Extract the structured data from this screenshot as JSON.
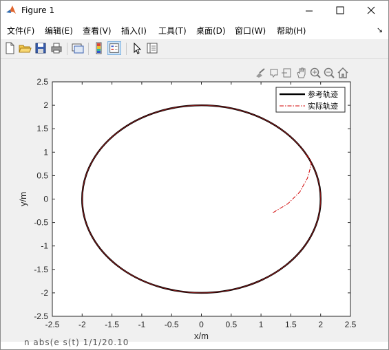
{
  "window": {
    "title": "Figure 1",
    "icon": "matlab-icon",
    "controls": [
      "minimize-icon",
      "maximize-icon",
      "close-icon"
    ]
  },
  "menu": {
    "items": [
      {
        "label": "文件(F)"
      },
      {
        "label": "编辑(E)"
      },
      {
        "label": "查看(V)"
      },
      {
        "label": "插入(I)"
      },
      {
        "label": "工具(T)"
      },
      {
        "label": "桌面(D)"
      },
      {
        "label": "窗口(W)"
      },
      {
        "label": "帮助(H)"
      }
    ],
    "overflow_icon": "menu-overflow-arrow-icon"
  },
  "toolbar": {
    "icons": [
      "new-figure-icon",
      "open-file-icon",
      "save-icon",
      "print-icon",
      "link-plot-icon",
      "insert-colorbar-icon",
      "insert-legend-icon",
      "edit-plot-arrow-icon",
      "property-inspector-icon"
    ],
    "pressed": "insert-legend-icon"
  },
  "axes_toolbar": {
    "icons": [
      "brush-icon",
      "data-tips-icon",
      "export-icon",
      "pan-hand-icon",
      "zoom-in-icon",
      "zoom-out-icon",
      "home-icon"
    ]
  },
  "chart_data": {
    "type": "line",
    "xlabel": "x/m",
    "ylabel": "y/m",
    "xlim": [
      -2.5,
      2.5
    ],
    "ylim": [
      -2.5,
      2.5
    ],
    "xticks": [
      "-2.5",
      "-2",
      "-1.5",
      "-1",
      "-0.5",
      "0",
      "0.5",
      "1",
      "1.5",
      "2",
      "2.5"
    ],
    "yticks": [
      "2.5",
      "2",
      "1.5",
      "1",
      "0.5",
      "0",
      "-0.5",
      "-1",
      "-1.5",
      "-2",
      "-2.5"
    ],
    "grid": false,
    "legend_position": "top-right",
    "series": [
      {
        "name": "参考轨迹",
        "color": "#000000",
        "style": "solid",
        "shape": "circle",
        "center": [
          0,
          0
        ],
        "radius": 2
      },
      {
        "name": "实际轨迹",
        "color": "#d00000",
        "style": "dash-dot",
        "x": [
          1.2,
          1.45,
          1.65,
          1.78,
          1.84,
          1.83,
          1.75
        ],
        "y": [
          -0.29,
          -0.1,
          0.15,
          0.45,
          0.72,
          0.84,
          0.95
        ]
      },
      {
        "name": "",
        "color": "#8b1a1a",
        "style": "solid",
        "shape": "circle",
        "center": [
          0,
          0
        ],
        "radius": 2
      }
    ]
  },
  "bottom_strip": {
    "text": "n  abs(e  s(t) 1/1/20.10"
  }
}
